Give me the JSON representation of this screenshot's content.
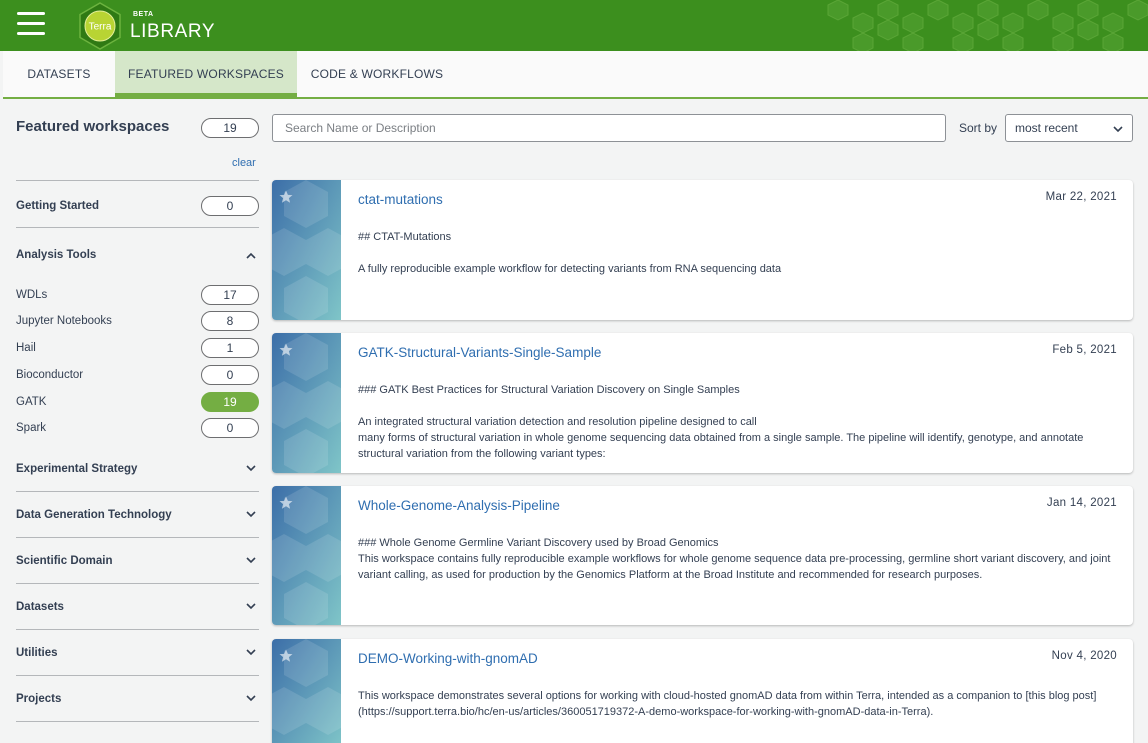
{
  "header": {
    "menu_icon": "hamburger-menu-icon",
    "logo_text": "Terra",
    "beta": "BETA",
    "title": "LIBRARY",
    "brand_color": "#3c8f1e"
  },
  "tabs": [
    {
      "label": "DATASETS"
    },
    {
      "label": "FEATURED WORKSPACES",
      "active": true
    },
    {
      "label": "CODE & WORKFLOWS"
    }
  ],
  "sidebar": {
    "title": "Featured workspaces",
    "total_count": "19",
    "clear_label": "clear",
    "getting_started": {
      "label": "Getting Started",
      "count": "0"
    },
    "analysis_tools": {
      "label": "Analysis Tools",
      "items": [
        {
          "label": "WDLs",
          "count": "17"
        },
        {
          "label": "Jupyter Notebooks",
          "count": "8"
        },
        {
          "label": "Hail",
          "count": "1"
        },
        {
          "label": "Bioconductor",
          "count": "0"
        },
        {
          "label": "GATK",
          "count": "19",
          "selected": true
        },
        {
          "label": "Spark",
          "count": "0"
        }
      ]
    },
    "sections": [
      {
        "label": "Experimental Strategy"
      },
      {
        "label": "Data Generation Technology"
      },
      {
        "label": "Scientific Domain"
      },
      {
        "label": "Datasets"
      },
      {
        "label": "Utilities"
      },
      {
        "label": "Projects"
      }
    ]
  },
  "search": {
    "placeholder": "Search Name or Description",
    "value": ""
  },
  "sort": {
    "label": "Sort by",
    "selected": "most recent"
  },
  "workspaces": [
    {
      "name": "ctat-mutations",
      "date": "Mar 22, 2021",
      "heading": "## CTAT-Mutations",
      "body": "A fully reproducible example workflow for detecting variants from RNA sequencing data"
    },
    {
      "name": "GATK-Structural-Variants-Single-Sample",
      "date": "Feb 5, 2021",
      "heading": "### GATK Best Practices for Structural Variation Discovery on Single Samples",
      "body": "An integrated structural variation detection and resolution pipeline designed to call\nmany forms of structural variation in whole genome sequencing data obtained from a single sample. The pipeline will identify, genotype, and annotate structural variation from the following variant types:"
    },
    {
      "name": "Whole-Genome-Analysis-Pipeline",
      "date": "Jan 14, 2021",
      "heading": "### Whole Genome Germline Variant Discovery used by Broad Genomics",
      "body": "This workspace contains fully reproducible example workflows for whole genome sequence data pre-processing, germline short variant discovery, and joint variant calling, as used for production by the Genomics Platform at the Broad Institute and recommended for research purposes."
    },
    {
      "name": "DEMO-Working-with-gnomAD",
      "date": "Nov 4, 2020",
      "heading": "",
      "body": "This workspace demonstrates several options for working with cloud-hosted gnomAD data from within Terra, intended as a companion to [this blog post](https://support.terra.bio/hc/en-us/articles/360051719372-A-demo-workspace-for-working-with-gnomAD-data-in-Terra)."
    }
  ]
}
